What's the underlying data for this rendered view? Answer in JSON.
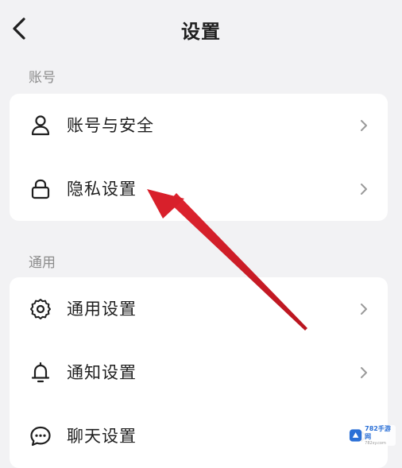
{
  "header": {
    "title": "设置",
    "back_icon": "chevron-left-icon"
  },
  "sections": [
    {
      "label": "账号",
      "items": [
        {
          "label": "账号与安全",
          "icon": "person-icon"
        },
        {
          "label": "隐私设置",
          "icon": "lock-icon"
        }
      ]
    },
    {
      "label": "通用",
      "items": [
        {
          "label": "通用设置",
          "icon": "gear-icon"
        },
        {
          "label": "通知设置",
          "icon": "bell-icon"
        },
        {
          "label": "聊天设置",
          "icon": "chat-bubble-icon"
        }
      ]
    }
  ],
  "annotation": {
    "arrow_color": "#d8202b",
    "points_to": "隐私设置"
  },
  "watermark": {
    "title": "782手游网",
    "subtitle": "782sy.com"
  },
  "colors": {
    "background": "#f2f2f4",
    "card": "#ffffff",
    "section_label": "#8c8c8c",
    "text": "#1f1f1f",
    "chevron": "#9a9a9a"
  }
}
